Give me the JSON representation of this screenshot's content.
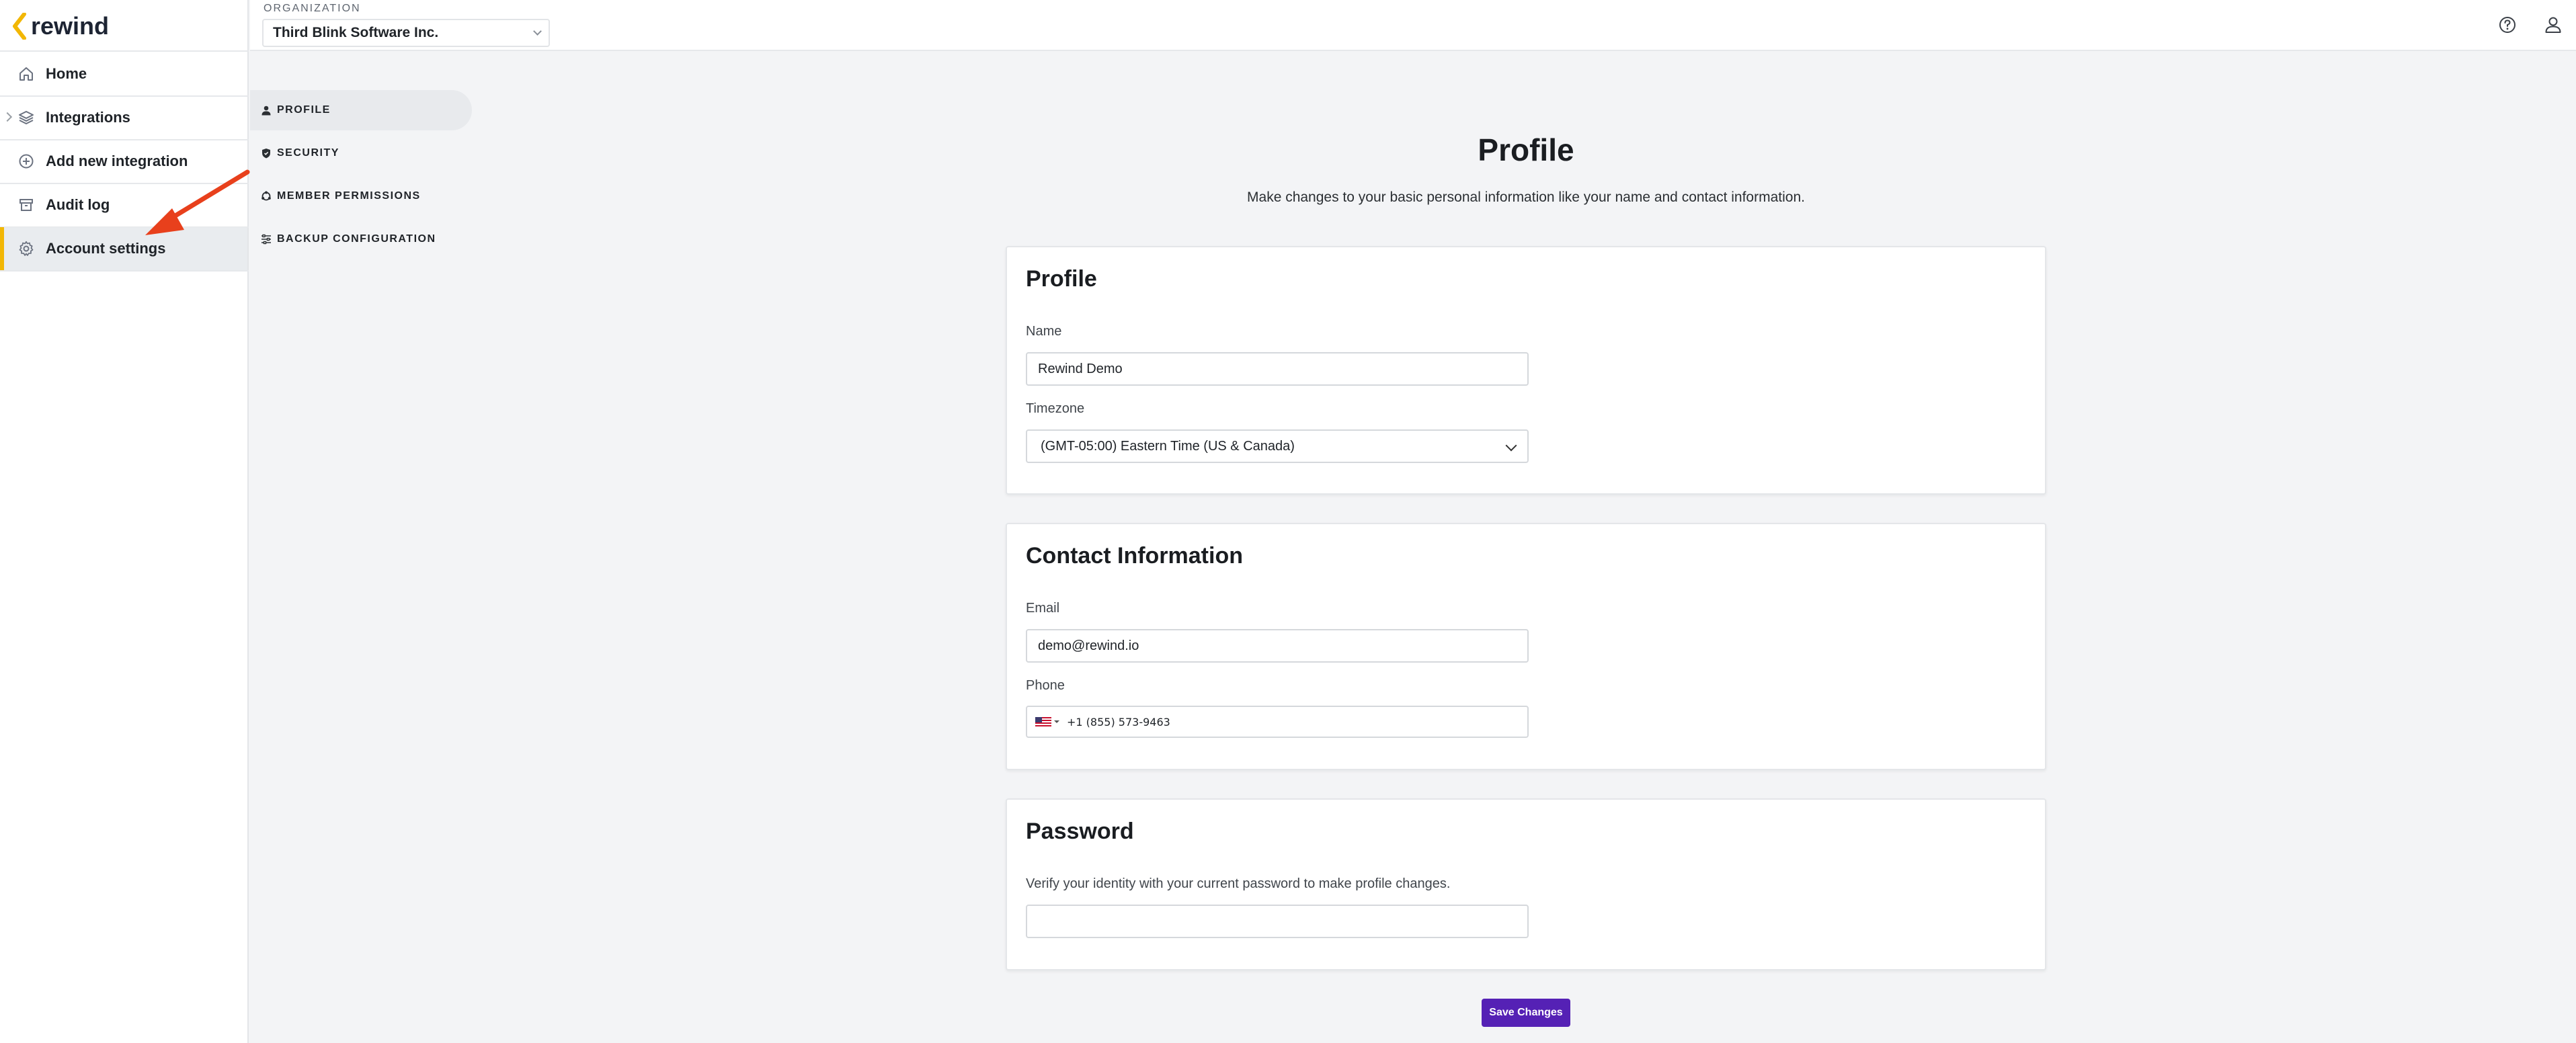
{
  "brand": {
    "name": "rewind",
    "accent": "#f2b705",
    "primary_button": "#5521b5"
  },
  "sidebar": {
    "items": [
      {
        "label": "Home",
        "icon": "home-icon"
      },
      {
        "label": "Integrations",
        "icon": "layers-icon"
      },
      {
        "label": "Add new integration",
        "icon": "plus-circle-icon"
      },
      {
        "label": "Audit log",
        "icon": "archive-icon"
      },
      {
        "label": "Account settings",
        "icon": "gear-icon",
        "active": true
      }
    ]
  },
  "topbar": {
    "org_label": "ORGANIZATION",
    "org_value": "Third Blink Software Inc."
  },
  "subnav": {
    "items": [
      {
        "label": "PROFILE",
        "icon": "person-icon",
        "active": true
      },
      {
        "label": "SECURITY",
        "icon": "shield-icon"
      },
      {
        "label": "MEMBER PERMISSIONS",
        "icon": "cycle-icon"
      },
      {
        "label": "BACKUP CONFIGURATION",
        "icon": "sliders-icon"
      }
    ]
  },
  "main": {
    "title": "Profile",
    "subtitle": "Make changes to your basic personal information like your name and contact information.",
    "profile_card": {
      "title": "Profile",
      "name_label": "Name",
      "name_value": "Rewind Demo",
      "timezone_label": "Timezone",
      "timezone_value": "(GMT-05:00) Eastern Time (US & Canada)"
    },
    "contact_card": {
      "title": "Contact Information",
      "email_label": "Email",
      "email_value": "demo@rewind.io",
      "phone_label": "Phone",
      "phone_value": "+1 (855) 573-9463"
    },
    "password_card": {
      "title": "Password",
      "hint": "Verify your identity with your current password to make profile changes.",
      "value": ""
    },
    "save_label": "Save Changes"
  }
}
